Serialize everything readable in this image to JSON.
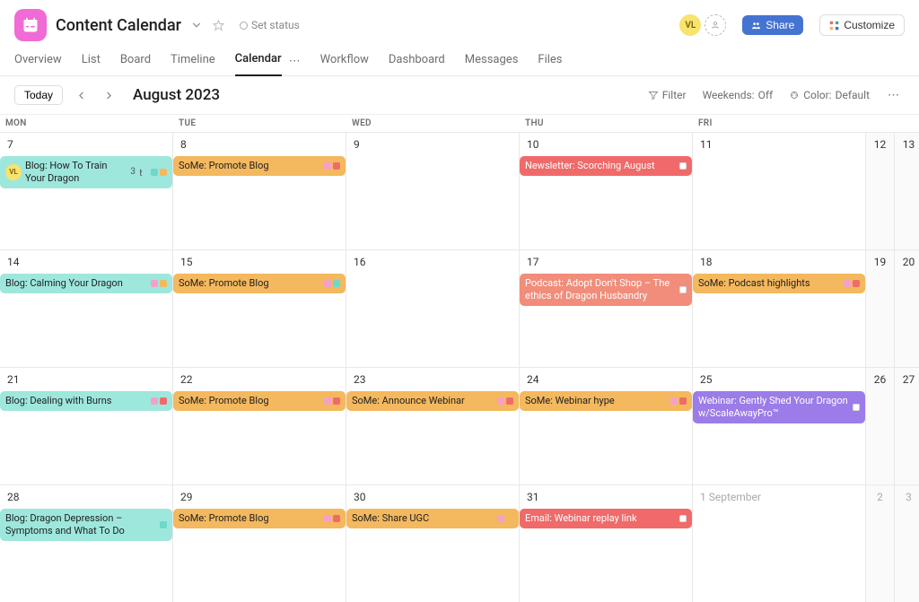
{
  "header": {
    "title": "Content Calendar",
    "set_status": "Set status",
    "avatar_initials": "VL",
    "share_label": "Share",
    "customize_label": "Customize"
  },
  "tabs": [
    {
      "label": "Overview"
    },
    {
      "label": "List"
    },
    {
      "label": "Board"
    },
    {
      "label": "Timeline"
    },
    {
      "label": "Calendar",
      "active": true
    },
    {
      "label": "Workflow"
    },
    {
      "label": "Dashboard"
    },
    {
      "label": "Messages"
    },
    {
      "label": "Files"
    }
  ],
  "toolbar": {
    "today": "Today",
    "month": "August 2023",
    "filter": "Filter",
    "weekends_label": "Weekends:",
    "weekends_value": "Off",
    "color_label": "Color:",
    "color_value": "Default"
  },
  "dayheads": [
    "MON",
    "TUE",
    "WED",
    "THU",
    "FRI",
    "",
    ""
  ],
  "weeks": [
    {
      "days": [
        {
          "num": "7",
          "events": [
            {
              "cls": "bg-teal",
              "text": "Blog: How To Train Your Dragon",
              "avatar": "VL",
              "meta_count": "3",
              "dots": [
                "d-teal",
                "d-orange"
              ]
            }
          ]
        },
        {
          "num": "8",
          "events": [
            {
              "cls": "bg-orange",
              "text": "SoMe: Promote Blog",
              "dots": [
                "d-pink",
                "d-red"
              ]
            }
          ]
        },
        {
          "num": "9",
          "events": []
        },
        {
          "num": "10",
          "events": [
            {
              "cls": "bg-red",
              "text": "Newsletter: Scorching August",
              "dots": [
                "d-white"
              ]
            }
          ]
        },
        {
          "num": "11",
          "events": []
        },
        {
          "num": "12",
          "weekend": true
        },
        {
          "num": "13",
          "weekend": true
        }
      ]
    },
    {
      "days": [
        {
          "num": "14",
          "events": [
            {
              "cls": "bg-teal",
              "text": "Blog: Calming Your Dragon",
              "dots": [
                "d-pink",
                "d-orange"
              ]
            }
          ]
        },
        {
          "num": "15",
          "events": [
            {
              "cls": "bg-orange",
              "text": "SoMe: Promote Blog",
              "dots": [
                "d-pink",
                "d-teal"
              ]
            }
          ]
        },
        {
          "num": "16",
          "events": []
        },
        {
          "num": "17",
          "events": [
            {
              "cls": "bg-salmon",
              "text": "Podcast: Adopt Don't Shop – The ethics of Dragon Husbandry",
              "dots": [
                "d-white"
              ]
            }
          ]
        },
        {
          "num": "18",
          "events": [
            {
              "cls": "bg-orange",
              "text": "SoMe: Podcast highlights",
              "dots": [
                "d-pink",
                "d-red"
              ]
            }
          ]
        },
        {
          "num": "19",
          "weekend": true
        },
        {
          "num": "20",
          "weekend": true
        }
      ]
    },
    {
      "days": [
        {
          "num": "21",
          "events": [
            {
              "cls": "bg-teal",
              "text": "Blog: Dealing with Burns",
              "dots": [
                "d-pink",
                "d-red"
              ]
            }
          ]
        },
        {
          "num": "22",
          "events": [
            {
              "cls": "bg-orange",
              "text": "SoMe: Promote Blog",
              "dots": [
                "d-pink",
                "d-red"
              ]
            }
          ]
        },
        {
          "num": "23",
          "events": [
            {
              "cls": "bg-orange",
              "text": "SoMe: Announce Webinar",
              "dots": [
                "d-pink",
                "d-red"
              ]
            }
          ]
        },
        {
          "num": "24",
          "events": [
            {
              "cls": "bg-orange",
              "text": "SoMe: Webinar hype",
              "dots": [
                "d-pink",
                "d-red"
              ]
            }
          ]
        },
        {
          "num": "25",
          "events": [
            {
              "cls": "bg-purple",
              "text": "Webinar: Gently Shed Your Dragon w/ScaleAwayPro™",
              "dots": [
                "d-white"
              ]
            }
          ]
        },
        {
          "num": "26",
          "weekend": true
        },
        {
          "num": "27",
          "weekend": true
        }
      ]
    },
    {
      "days": [
        {
          "num": "28",
          "events": [
            {
              "cls": "bg-teal",
              "text": "Blog: Dragon Depression – Symptoms and What To Do",
              "dots": [
                "d-teal"
              ]
            }
          ]
        },
        {
          "num": "29",
          "events": [
            {
              "cls": "bg-orange",
              "text": "SoMe: Promote Blog",
              "dots": [
                "d-pink",
                "d-red"
              ]
            }
          ]
        },
        {
          "num": "30",
          "events": [
            {
              "cls": "bg-orange",
              "text": "SoMe: Share UGC",
              "dots": [
                "d-pink",
                "d-orange"
              ]
            }
          ]
        },
        {
          "num": "31",
          "events": [
            {
              "cls": "bg-red",
              "text": "Email: Webinar replay link",
              "dots": [
                "d-white"
              ]
            }
          ]
        },
        {
          "num": "1 September",
          "dim": true,
          "events": []
        },
        {
          "num": "2",
          "weekend": true,
          "dim": true
        },
        {
          "num": "3",
          "weekend": true,
          "dim": true
        }
      ]
    }
  ]
}
